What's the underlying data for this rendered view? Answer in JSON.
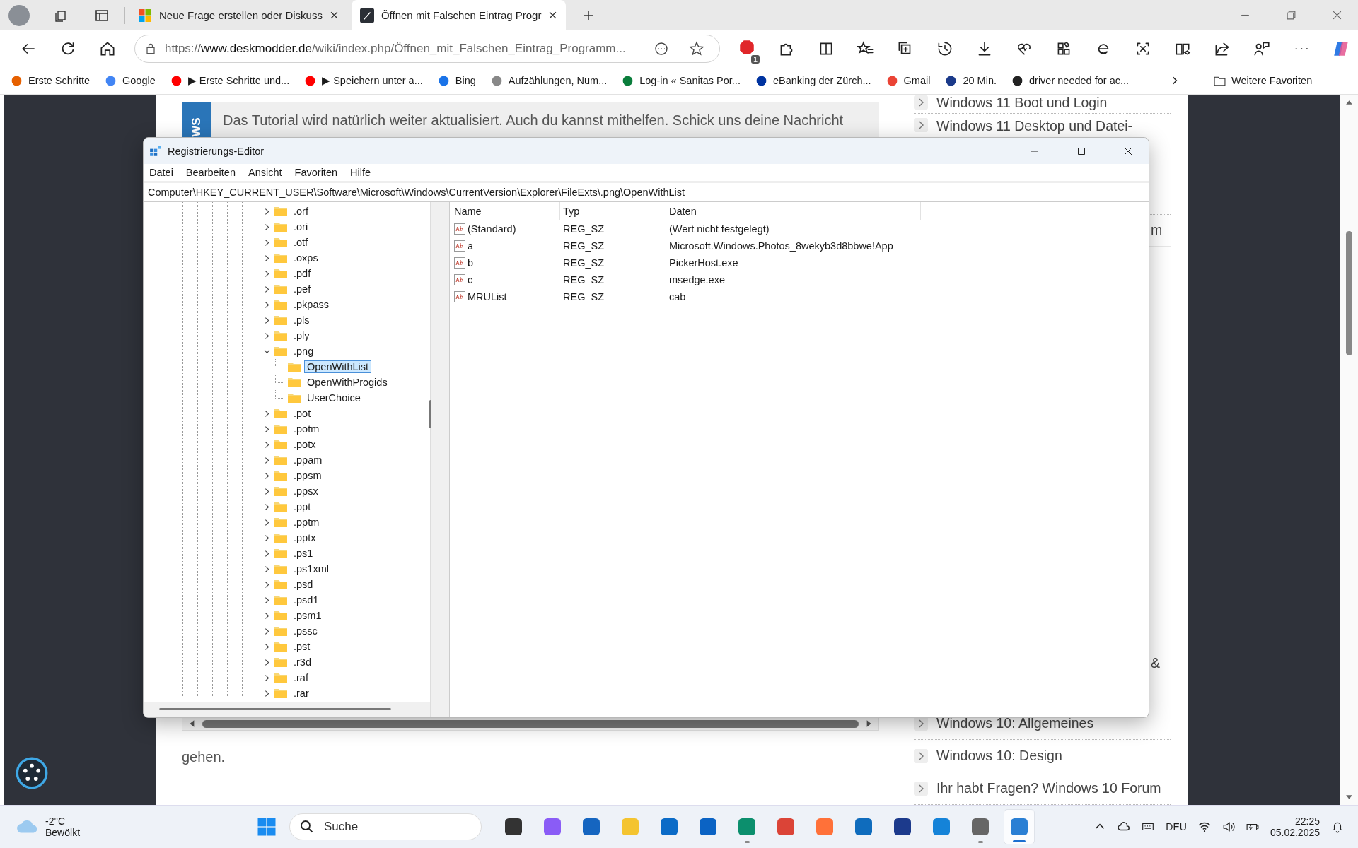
{
  "browser": {
    "tabs": [
      {
        "title": "Neue Frage erstellen oder Diskuss",
        "selected": false
      },
      {
        "title": "Öffnen mit Falschen Eintrag Progr",
        "selected": true
      }
    ],
    "address": {
      "scheme": "https://",
      "host": "www.deskmodder.de",
      "path": "/wiki/index.php/Öffnen_mit_Falschen_Eintrag_Programm..."
    },
    "extension_badge": "1",
    "favorites": [
      {
        "label": "Erste Schritte"
      },
      {
        "label": "Google"
      },
      {
        "label": "▶ Erste Schritte und..."
      },
      {
        "label": "▶ Speichern unter a..."
      },
      {
        "label": "Bing"
      },
      {
        "label": "Aufzählungen, Num..."
      },
      {
        "label": "Log-in « Sanitas Por..."
      },
      {
        "label": "eBanking der Zürch..."
      },
      {
        "label": "Gmail"
      },
      {
        "label": "20 Min."
      },
      {
        "label": "driver needed for ac..."
      }
    ],
    "more_favorites": "Weitere Favoriten"
  },
  "page": {
    "news_badge": "WS",
    "notice": "Das Tutorial wird natürlich weiter aktualisiert. Auch du kannst mithelfen. Schick uns deine Nachricht",
    "after_text": "gehen.",
    "sidebar": [
      {
        "label": "Windows 11 Boot und Login",
        "kind": "link"
      },
      {
        "label": "Windows 11 Desktop und Datei-",
        "kind": "link"
      },
      {
        "label": "m",
        "kind": "fragment"
      },
      {
        "label": "&",
        "kind": "fragment"
      },
      {
        "label": "Windows 10: Allgemeines",
        "kind": "link"
      },
      {
        "label": "Windows 10: Design",
        "kind": "link"
      },
      {
        "label": "Ihr habt Fragen? Windows 10 Forum",
        "kind": "link"
      }
    ]
  },
  "regedit": {
    "title": "Registrierungs-Editor",
    "menu": [
      "Datei",
      "Bearbeiten",
      "Ansicht",
      "Favoriten",
      "Hilfe"
    ],
    "address": "Computer\\HKEY_CURRENT_USER\\Software\\Microsoft\\Windows\\CurrentVersion\\Explorer\\FileExts\\.png\\OpenWithList",
    "tree": [
      {
        "label": ".orf",
        "expanded": false,
        "selected": false
      },
      {
        "label": ".ori",
        "expanded": false,
        "selected": false
      },
      {
        "label": ".otf",
        "expanded": false,
        "selected": false
      },
      {
        "label": ".oxps",
        "expanded": false,
        "selected": false
      },
      {
        "label": ".pdf",
        "expanded": false,
        "selected": false
      },
      {
        "label": ".pef",
        "expanded": false,
        "selected": false
      },
      {
        "label": ".pkpass",
        "expanded": false,
        "selected": false
      },
      {
        "label": ".pls",
        "expanded": false,
        "selected": false
      },
      {
        "label": ".ply",
        "expanded": false,
        "selected": false
      },
      {
        "label": ".png",
        "expanded": true,
        "selected": false,
        "children": [
          {
            "label": "OpenWithList",
            "selected": true
          },
          {
            "label": "OpenWithProgids",
            "selected": false
          },
          {
            "label": "UserChoice",
            "selected": false
          }
        ]
      },
      {
        "label": ".pot",
        "expanded": false,
        "selected": false
      },
      {
        "label": ".potm",
        "expanded": false,
        "selected": false
      },
      {
        "label": ".potx",
        "expanded": false,
        "selected": false
      },
      {
        "label": ".ppam",
        "expanded": false,
        "selected": false
      },
      {
        "label": ".ppsm",
        "expanded": false,
        "selected": false
      },
      {
        "label": ".ppsx",
        "expanded": false,
        "selected": false
      },
      {
        "label": ".ppt",
        "expanded": false,
        "selected": false
      },
      {
        "label": ".pptm",
        "expanded": false,
        "selected": false
      },
      {
        "label": ".pptx",
        "expanded": false,
        "selected": false
      },
      {
        "label": ".ps1",
        "expanded": false,
        "selected": false
      },
      {
        "label": ".ps1xml",
        "expanded": false,
        "selected": false
      },
      {
        "label": ".psd",
        "expanded": false,
        "selected": false
      },
      {
        "label": ".psd1",
        "expanded": false,
        "selected": false
      },
      {
        "label": ".psm1",
        "expanded": false,
        "selected": false
      },
      {
        "label": ".pssc",
        "expanded": false,
        "selected": false
      },
      {
        "label": ".pst",
        "expanded": false,
        "selected": false
      },
      {
        "label": ".r3d",
        "expanded": false,
        "selected": false
      },
      {
        "label": ".raf",
        "expanded": false,
        "selected": false
      },
      {
        "label": ".rar",
        "expanded": false,
        "selected": false
      }
    ],
    "columns": [
      "Name",
      "Typ",
      "Daten"
    ],
    "values": [
      {
        "name": "(Standard)",
        "type": "REG_SZ",
        "data": "(Wert nicht festgelegt)"
      },
      {
        "name": "a",
        "type": "REG_SZ",
        "data": "Microsoft.Windows.Photos_8wekyb3d8bbwe!App"
      },
      {
        "name": "b",
        "type": "REG_SZ",
        "data": "PickerHost.exe"
      },
      {
        "name": "c",
        "type": "REG_SZ",
        "data": "msedge.exe"
      },
      {
        "name": "MRUList",
        "type": "REG_SZ",
        "data": "cab"
      }
    ]
  },
  "taskbar": {
    "weather": {
      "temperature": "-2°C",
      "condition": "Bewölkt"
    },
    "search": {
      "placeholder": "Suche"
    },
    "apps": [
      {
        "running": false,
        "selected": false
      },
      {
        "running": false,
        "selected": false
      },
      {
        "running": false,
        "selected": false
      },
      {
        "running": false,
        "selected": false
      },
      {
        "running": false,
        "selected": false
      },
      {
        "running": false,
        "selected": false
      },
      {
        "running": true,
        "selected": false
      },
      {
        "running": false,
        "selected": false
      },
      {
        "running": false,
        "selected": false
      },
      {
        "running": false,
        "selected": false
      },
      {
        "running": false,
        "selected": false
      },
      {
        "running": false,
        "selected": false
      },
      {
        "running": true,
        "selected": false
      },
      {
        "running": true,
        "selected": true
      }
    ],
    "language": "DEU",
    "time": "22:25",
    "date": "05.02.2025"
  }
}
